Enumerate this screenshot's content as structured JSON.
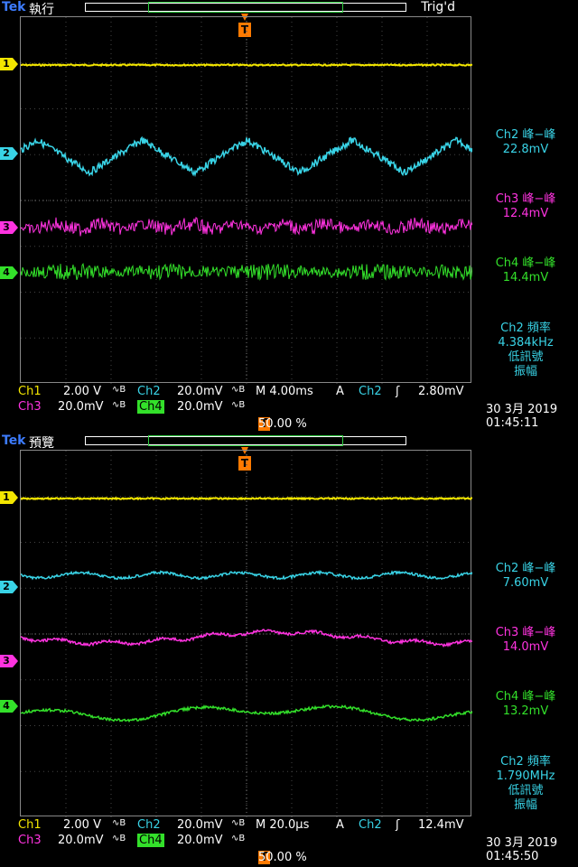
{
  "colors": {
    "ch1": "#f3e600",
    "ch2": "#39d3e6",
    "ch3": "#ff33e0",
    "ch4": "#33e02a",
    "trigger": "#ff7a00"
  },
  "panels": [
    {
      "brand": "Tek",
      "mode": "執行",
      "trigger_status": "Trig'd",
      "trigger_marker": "T",
      "channel_markers": [
        "1",
        "2",
        "3",
        "4"
      ],
      "measurements": [
        {
          "title": "Ch2 峰−峰",
          "value": "22.8mV"
        },
        {
          "title": "Ch3 峰−峰",
          "value": "12.4mV"
        },
        {
          "title": "Ch4 峰−峰",
          "value": "14.4mV"
        }
      ],
      "freq": {
        "title": "Ch2 頻率",
        "value": "4.384kHz",
        "note1": "低訊號",
        "note2": "振幅"
      },
      "ch1_label": "Ch1",
      "ch1_scale": "2.00 V",
      "ch2_label": "Ch2",
      "ch2_scale": "20.0mV",
      "ch3_label": "Ch3",
      "ch3_scale": "20.0mV",
      "ch4_label": "Ch4",
      "ch4_scale": "20.0mV",
      "bw_symbol": "∿B",
      "timebase": "M 4.00ms",
      "trig_source_mode": "A",
      "trig_channel": "Ch2",
      "trig_slope": "ʃ",
      "trig_level": "2.80mV",
      "position": "50.00 %",
      "date": "30 3月  2019",
      "time": "01:45:11",
      "waves": {
        "ch2": {
          "type": "triangle",
          "cycles": 4.3,
          "amp": 0.09
        },
        "ch3": {
          "type": "noise"
        },
        "ch4": {
          "type": "noise"
        }
      }
    },
    {
      "brand": "Tek",
      "mode": "預覽",
      "trigger_status": "",
      "trigger_marker": "T",
      "channel_markers": [
        "1",
        "2",
        "3",
        "4"
      ],
      "measurements": [
        {
          "title": "Ch2 峰−峰",
          "value": "7.60mV"
        },
        {
          "title": "Ch3 峰−峰",
          "value": "14.0mV"
        },
        {
          "title": "Ch4 峰−峰",
          "value": "13.2mV"
        }
      ],
      "freq": {
        "title": "Ch2 頻率",
        "value": "1.790MHz",
        "note1": "低訊號",
        "note2": "振幅"
      },
      "ch1_label": "Ch1",
      "ch1_scale": "2.00 V",
      "ch2_label": "Ch2",
      "ch2_scale": "20.0mV",
      "ch3_label": "Ch3",
      "ch3_scale": "20.0mV",
      "ch4_label": "Ch4",
      "ch4_scale": "20.0mV",
      "bw_symbol": "∿B",
      "timebase": "M 20.0µs",
      "trig_source_mode": "A",
      "trig_channel": "Ch2",
      "trig_slope": "ʃ",
      "trig_level": "12.4mV",
      "position": "50.00 %",
      "date": "30 3月  2019",
      "time": "01:45:50",
      "waves": {
        "ch2": {
          "type": "ripple"
        },
        "ch3": {
          "type": "ripple"
        },
        "ch4": {
          "type": "ripple"
        }
      }
    }
  ]
}
